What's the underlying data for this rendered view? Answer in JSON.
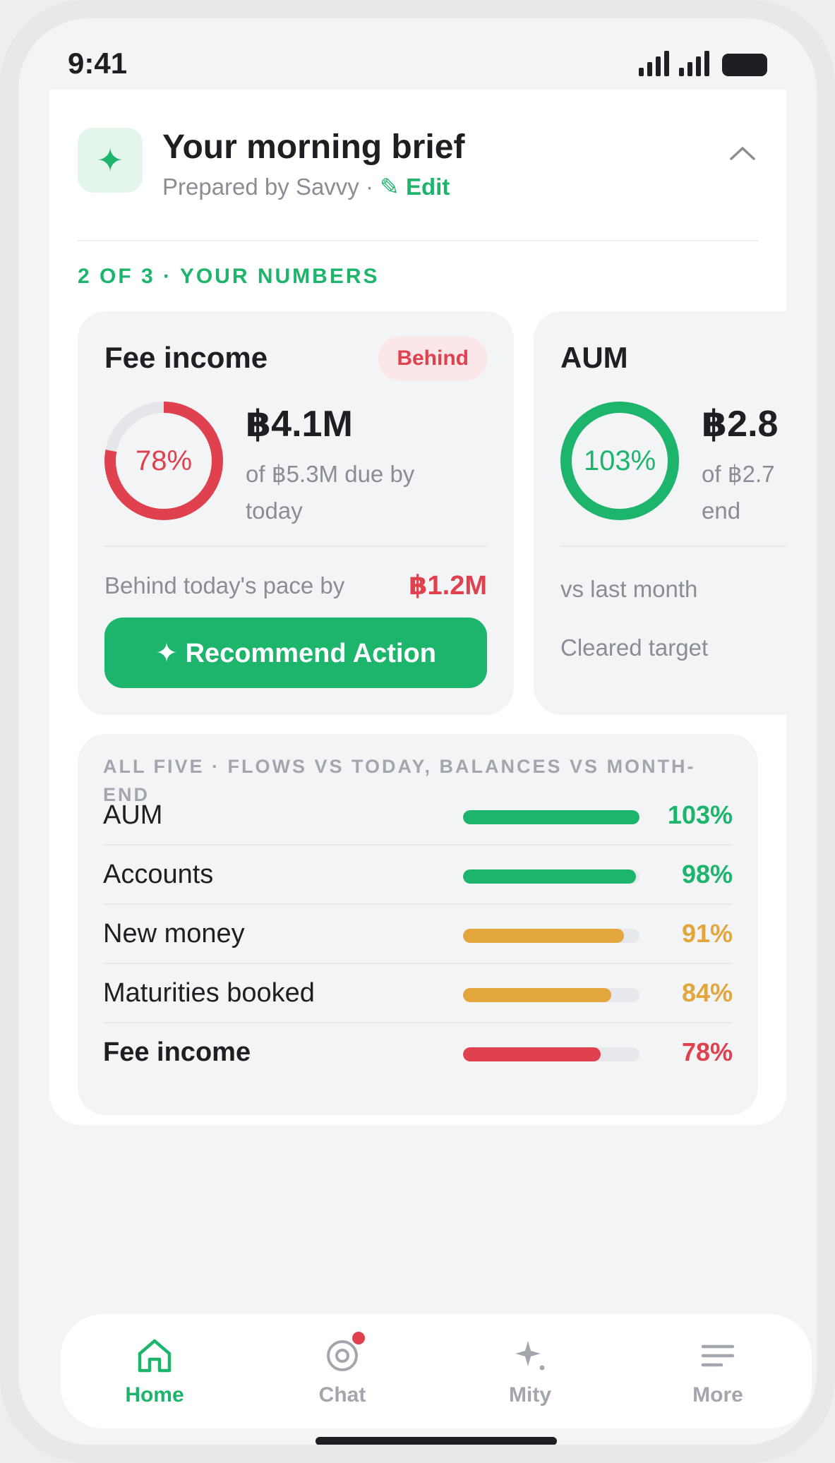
{
  "status_bar": {
    "time": "9:41"
  },
  "brief": {
    "title": "Your morning brief",
    "prepared_by": "Prepared by Savvy · ",
    "edit_label": "✎ Edit",
    "section_label": "2 OF 3 · YOUR NUMBERS"
  },
  "cards": {
    "fee": {
      "title": "Fee income",
      "badge": "Behind",
      "progress": 78,
      "progress_label": "78%",
      "value": "฿4.1M",
      "sub": "of ฿5.3M due by today",
      "pace_label": "Behind today's pace by",
      "pace_value": "฿1.2M",
      "button_label": "✦ Recommend Action"
    },
    "aum": {
      "title": "AUM",
      "progress": 103,
      "progress_label": "103%",
      "value": "฿2.8",
      "sub": "of ฿2.7 end",
      "line1": "vs last month",
      "line2": "Cleared target"
    }
  },
  "summary": {
    "header": "ALL FIVE · FLOWS VS TODAY, BALANCES VS MONTH-END",
    "rows": [
      {
        "label": "AUM",
        "pct": 103,
        "pct_label": "103%",
        "color": "#1db56c",
        "bold": false
      },
      {
        "label": "Accounts",
        "pct": 98,
        "pct_label": "98%",
        "color": "#1db56c",
        "bold": false
      },
      {
        "label": "New money",
        "pct": 91,
        "pct_label": "91%",
        "color": "#e3a63c",
        "bold": false
      },
      {
        "label": "Maturities booked",
        "pct": 84,
        "pct_label": "84%",
        "color": "#e3a63c",
        "bold": false
      },
      {
        "label": "Fee income",
        "pct": 78,
        "pct_label": "78%",
        "color": "#e0414f",
        "bold": true
      }
    ]
  },
  "nav": {
    "items": [
      {
        "label": "Home",
        "icon": "home-icon",
        "active": true
      },
      {
        "label": "Chat",
        "icon": "chat-icon",
        "active": false,
        "has_badge": true
      },
      {
        "label": "Mity",
        "icon": "sparkle-icon",
        "active": false
      },
      {
        "label": "More",
        "icon": "menu-icon",
        "active": false
      }
    ]
  },
  "colors": {
    "accent": "#1db56c",
    "danger": "#e0414f",
    "warning": "#e3a63c"
  }
}
